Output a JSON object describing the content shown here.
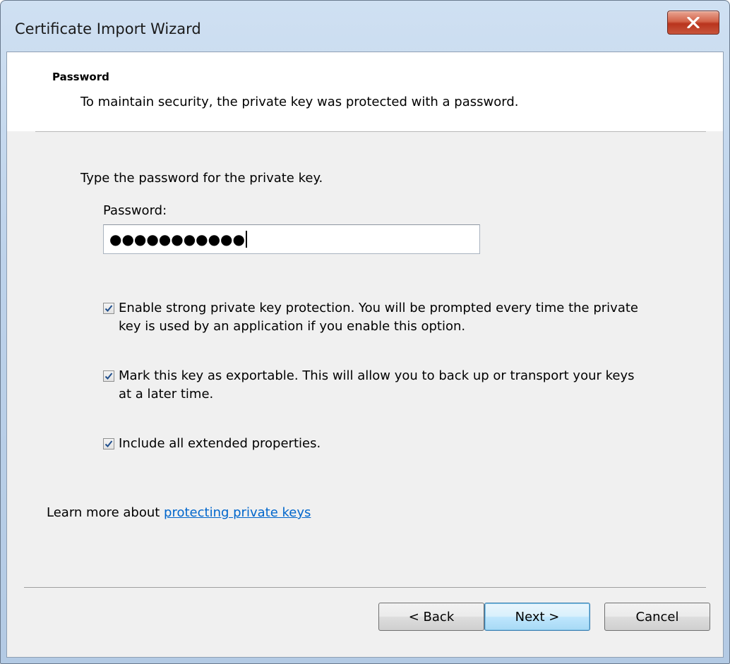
{
  "window": {
    "title": "Certificate Import Wizard",
    "close_label": "x"
  },
  "header": {
    "title": "Password",
    "subtitle": "To maintain security, the private key was protected with a password."
  },
  "main": {
    "instruction": "Type the password for the private key.",
    "password_label": "Password:",
    "password_value": "●●●●●●●●●●●",
    "options": [
      {
        "label": "Enable strong private key protection. You will be prompted every time the private key is used by an application if you enable this option.",
        "checked": true
      },
      {
        "label": "Mark this key as exportable. This will allow you to back up or transport your keys at a later time.",
        "checked": true
      },
      {
        "label": "Include all extended properties.",
        "checked": true
      }
    ],
    "learn_more_prefix": "Learn more about ",
    "learn_more_link": "protecting private keys"
  },
  "buttons": {
    "back": "< Back",
    "next": "Next >",
    "cancel": "Cancel"
  },
  "colors": {
    "link": "#0066cc",
    "close_button": "#c8553c",
    "checkmark": "#1f4e8c"
  }
}
